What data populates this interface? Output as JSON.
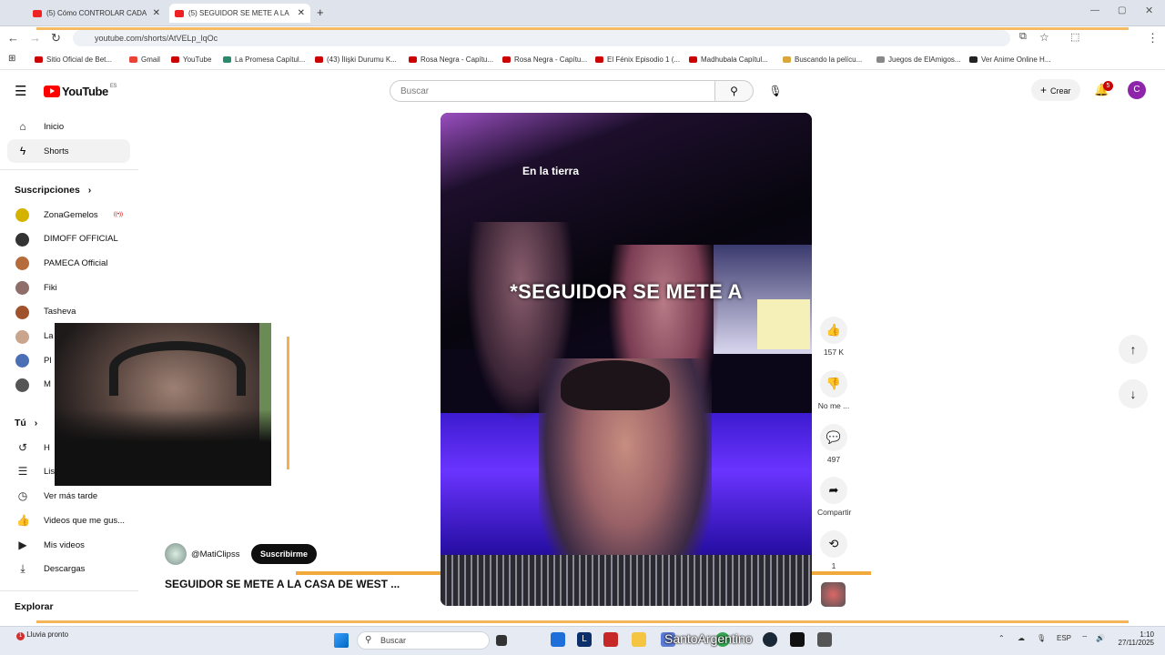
{
  "browser": {
    "tabs": [
      {
        "title": "(5) Cómo CONTROLAR CADA"
      },
      {
        "title": "(5) SEGUIDOR SE METE A LA"
      }
    ],
    "url": "youtube.com/shorts/AtVELp_lqOc",
    "bookmarks": [
      "Sitio Oficial de Bet...",
      "Gmail",
      "YouTube",
      "La Promesa Capítul...",
      "(43) İlişki Durumu K...",
      "Rosa Negra - Capítu...",
      "Rosa Negra - Capítu...",
      "El Fénix Episodio 1 (...",
      "Madhubala Capítul...",
      "Buscando la pelícu...",
      "Juegos de ElAmigos...",
      "Ver Anime Online H..."
    ]
  },
  "header": {
    "logo_text": "YouTube",
    "logo_region": "ES",
    "search_placeholder": "Buscar",
    "create_label": "Crear",
    "notification_count": "5",
    "avatar_letter": "C"
  },
  "sidebar": {
    "main": [
      {
        "label": "Inicio",
        "icon": "home-icon"
      },
      {
        "label": "Shorts",
        "icon": "shorts-icon"
      }
    ],
    "subscriptions_title": "Suscripciones",
    "subscriptions": [
      {
        "label": "ZonaGemelos",
        "color": "#d4b200"
      },
      {
        "label": "DIMOFF OFFICIAL",
        "color": "#333333"
      },
      {
        "label": "PAMECA Official",
        "color": "#b56b3a"
      },
      {
        "label": "Fiki",
        "color": "#8f6e6a"
      },
      {
        "label": "Tasheva",
        "color": "#a0522d"
      },
      {
        "label": "La",
        "color": "#c9a58e"
      },
      {
        "label": "Pl",
        "color": "#4a6fb5"
      },
      {
        "label": "M",
        "color": "#555555"
      }
    ],
    "you_title": "Tú",
    "you_items": [
      {
        "label": "H",
        "icon": "history-icon"
      },
      {
        "label": "Lis",
        "icon": "playlist-icon"
      },
      {
        "label": "Ver más tarde",
        "icon": "clock-icon"
      },
      {
        "label": "Videos que me gus...",
        "icon": "thumbs-up-icon"
      },
      {
        "label": "Mis videos",
        "icon": "my-videos-icon"
      },
      {
        "label": "Descargas",
        "icon": "download-icon"
      }
    ],
    "explore_title": "Explorar"
  },
  "short": {
    "top_caption": "En la tierra",
    "overlay_caption": "*SEGUIDOR SE METE A",
    "channel": "@MatiClipss",
    "subscribe_label": "Suscribirme",
    "title": "SEGUIDOR SE METE A LA CASA DE WEST ...",
    "likes": "157 K",
    "dislike_label": "No me ...",
    "comments": "497",
    "share_label": "Compartir",
    "remix_count": "1"
  },
  "taskbar": {
    "weather": "Lluvia pronto",
    "search_text": "Buscar",
    "watermark": "SantoArgentino",
    "lang": "ESP",
    "time": "1:10",
    "date": "27/11/2025"
  }
}
